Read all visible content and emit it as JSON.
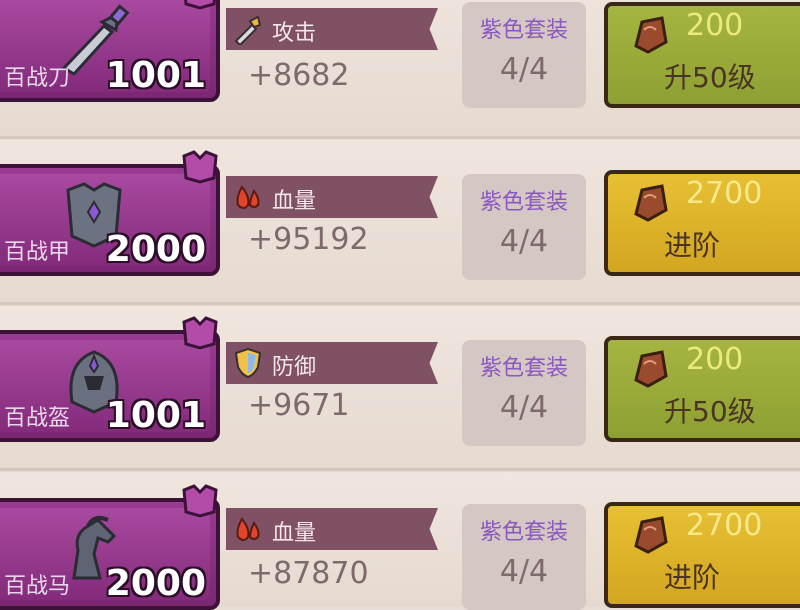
{
  "items": [
    {
      "name": "百战刀",
      "level": "1001",
      "art_icon": "sword-icon",
      "stat": {
        "icon": "sword-icon",
        "label": "攻击",
        "value": "+8682"
      },
      "set": {
        "label": "紫色套装",
        "count": "4/4"
      },
      "action": {
        "cost": "200",
        "label": "升50级",
        "style": "green"
      }
    },
    {
      "name": "百战甲",
      "level": "2000",
      "art_icon": "armor-icon",
      "stat": {
        "icon": "blood-drop-icon",
        "label": "血量",
        "value": "+95192"
      },
      "set": {
        "label": "紫色套装",
        "count": "4/4"
      },
      "action": {
        "cost": "2700",
        "label": "进阶",
        "style": "gold"
      }
    },
    {
      "name": "百战盔",
      "level": "1001",
      "art_icon": "helmet-icon",
      "stat": {
        "icon": "shield-icon",
        "label": "防御",
        "value": "+9671"
      },
      "set": {
        "label": "紫色套装",
        "count": "4/4"
      },
      "action": {
        "cost": "200",
        "label": "升50级",
        "style": "green"
      }
    },
    {
      "name": "百战马",
      "level": "2000",
      "art_icon": "horse-icon",
      "stat": {
        "icon": "blood-drop-icon",
        "label": "血量",
        "value": "+87870"
      },
      "set": {
        "label": "紫色套装",
        "count": "4/4"
      },
      "action": {
        "cost": "2700",
        "label": "进阶",
        "style": "gold"
      }
    }
  ],
  "colors": {
    "card_purple": "#8e3187",
    "banner": "#805164",
    "set_text": "#8a58c0",
    "btn_green": "#9aab3a",
    "btn_gold": "#dcb02a"
  }
}
